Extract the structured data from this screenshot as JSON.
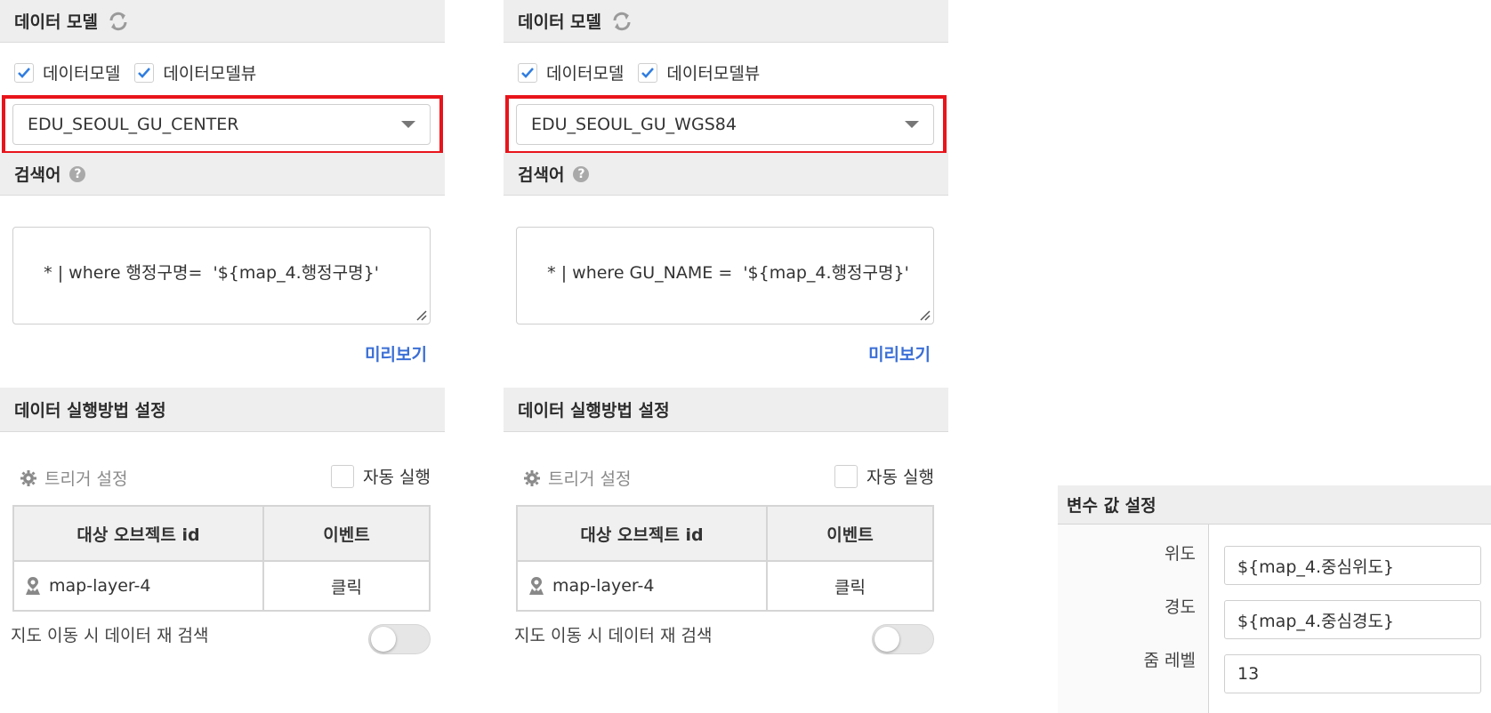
{
  "panels": [
    {
      "data_model_header": "데이터 모델",
      "checkbox_data_model": "데이터모델",
      "checkbox_data_model_view": "데이터모델뷰",
      "selected_model": "EDU_SEOUL_GU_CENTER",
      "search_header": "검색어",
      "query": "* | where 행정구명=  '${map_4.행정구명}'",
      "preview_link": "미리보기",
      "exec_header": "데이터 실행방법 설정",
      "trigger_label": "트리거 설정",
      "auto_run_label": "자동 실행",
      "table_headers": [
        "대상 오브젝트 id",
        "이벤트"
      ],
      "table_rows": [
        {
          "object_id": "map-layer-4",
          "event": "클릭"
        }
      ],
      "remap_label": "지도 이동 시 데이터 재 검색"
    },
    {
      "data_model_header": "데이터 모델",
      "checkbox_data_model": "데이터모델",
      "checkbox_data_model_view": "데이터모델뷰",
      "selected_model": "EDU_SEOUL_GU_WGS84",
      "search_header": "검색어",
      "query": "* | where GU_NAME =  '${map_4.행정구명}'",
      "preview_link": "미리보기",
      "exec_header": "데이터 실행방법 설정",
      "trigger_label": "트리거 설정",
      "auto_run_label": "자동 실행",
      "table_headers": [
        "대상 오브젝트 id",
        "이벤트"
      ],
      "table_rows": [
        {
          "object_id": "map-layer-4",
          "event": "클릭"
        }
      ],
      "remap_label": "지도 이동 시 데이터 재 검색"
    }
  ],
  "variables": {
    "header": "변수 값 설정",
    "rows": [
      {
        "label": "위도",
        "value": "${map_4.중심위도}"
      },
      {
        "label": "경도",
        "value": "${map_4.중심경도}"
      },
      {
        "label": "줌 레벨",
        "value": "13"
      }
    ]
  },
  "colors": {
    "highlight": "#e8141b",
    "link": "#3b6fd6",
    "checkbox_check": "#2f7de1"
  },
  "icons": [
    "refresh-icon",
    "help-icon",
    "checkbox-check-icon",
    "chevron-down-icon",
    "gear-icon",
    "map-layer-icon",
    "resize-grip-icon"
  ]
}
